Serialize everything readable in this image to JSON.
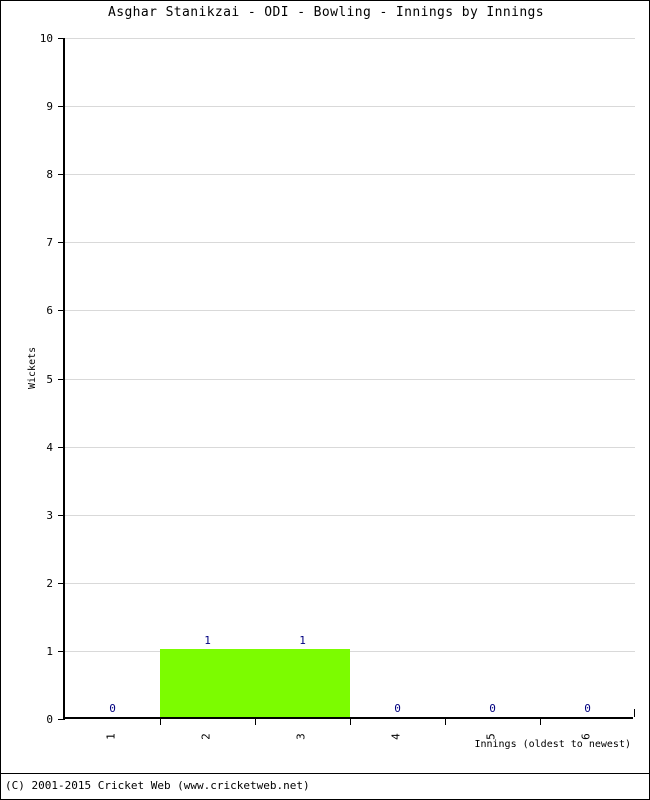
{
  "chart_data": {
    "type": "bar",
    "title": "Asghar Stanikzai - ODI - Bowling - Innings by Innings",
    "xlabel": "Innings (oldest to newest)",
    "ylabel": "Wickets",
    "categories": [
      "1",
      "2",
      "3",
      "4",
      "5",
      "6"
    ],
    "values": [
      0,
      1,
      1,
      0,
      0,
      0
    ],
    "value_labels": [
      "0",
      "1",
      "1",
      "0",
      "0",
      "0"
    ],
    "ylim": [
      0,
      10
    ],
    "yticks": [
      "0",
      "1",
      "2",
      "3",
      "4",
      "5",
      "6",
      "7",
      "8",
      "9",
      "10"
    ],
    "xlim": [
      0,
      6
    ],
    "grid": true,
    "legend": false,
    "bar_color": "#7CFC00",
    "value_label_color": "#000080",
    "gridline_color": "#D9D9D9",
    "axis_color": "#000000",
    "background_color": "#FFFFFF"
  },
  "footer": {
    "copyright": "(C) 2001-2015 Cricket Web (www.cricketweb.net)"
  }
}
